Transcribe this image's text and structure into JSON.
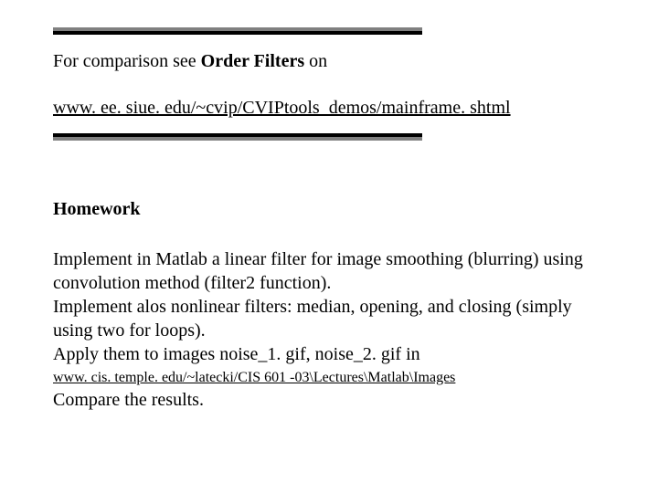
{
  "section1": {
    "prefix": "For comparison see ",
    "bold": "Order Filters",
    "suffix": " on",
    "link": "www. ee. siue. edu/~cvip/CVIPtools_demos/mainframe. shtml"
  },
  "homework": {
    "title": "Homework",
    "body": "Implement in Matlab a linear filter for image smoothing (blurring) using convolution method (filter2 function).\nImplement alos nonlinear filters: median, opening, and closing (simply using two for loops).\nApply them to images noise_1. gif, noise_2. gif in",
    "link": "www. cis. temple. edu/~latecki/CIS 601 -03\\Lectures\\Matlab\\Images",
    "final": "Compare the results."
  }
}
